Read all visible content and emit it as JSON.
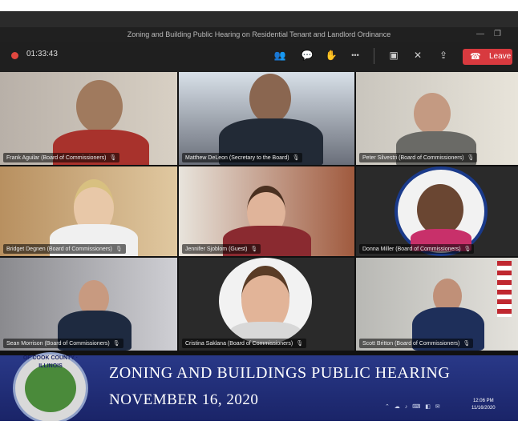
{
  "window": {
    "title": "Zoning and Building Public Hearing on Residential Tenant and Landlord Ordinance",
    "min_icon": "—",
    "restore_icon": "❐"
  },
  "callbar": {
    "timer": "01:33:43",
    "leave_label": "Leave",
    "record_color": "#e0473f",
    "leave_color": "#d83a3f",
    "controls": [
      {
        "name": "people-icon",
        "glyph": "👥"
      },
      {
        "name": "chat-icon",
        "glyph": "💬"
      },
      {
        "name": "raise-hand-icon",
        "glyph": "✋"
      },
      {
        "name": "more-icon",
        "glyph": "•••"
      },
      {
        "name": "camera-off-icon",
        "glyph": "▣"
      },
      {
        "name": "mic-off-icon",
        "glyph": "✕"
      },
      {
        "name": "share-icon",
        "glyph": "⇪"
      }
    ]
  },
  "participants": [
    {
      "label": "Frank Aguilar (Board of Commissioners)"
    },
    {
      "label": "Matthew DeLeon (Secretary to the Board)"
    },
    {
      "label": "Peter Silvestri (Board of Commissioners)"
    },
    {
      "label": "Bridget Degnen (Board of Commissioners)"
    },
    {
      "label": "Jennifer Sjoblom (Guest)"
    },
    {
      "label": "Donna Miller (Board of Commissioners)"
    },
    {
      "label": "Sean Morrison (Board of Commissioners)"
    },
    {
      "label": "Cristina Saklana (Board of Commissioners)"
    },
    {
      "label": "Scott Britton (Board of Commissioners)"
    }
  ],
  "mic_glyph": "🎙",
  "banner": {
    "title": "ZONING AND BUILDINGS PUBLIC HEARING",
    "date": "NOVEMBER 16, 2020",
    "seal_text": "OF COOK COUNTY · ILLINOIS"
  },
  "taskbar": {
    "time": "12:06 PM",
    "date": "11/16/2020",
    "icons": "⌃ ☁ ♪ ⌨ ◧ ✉"
  }
}
